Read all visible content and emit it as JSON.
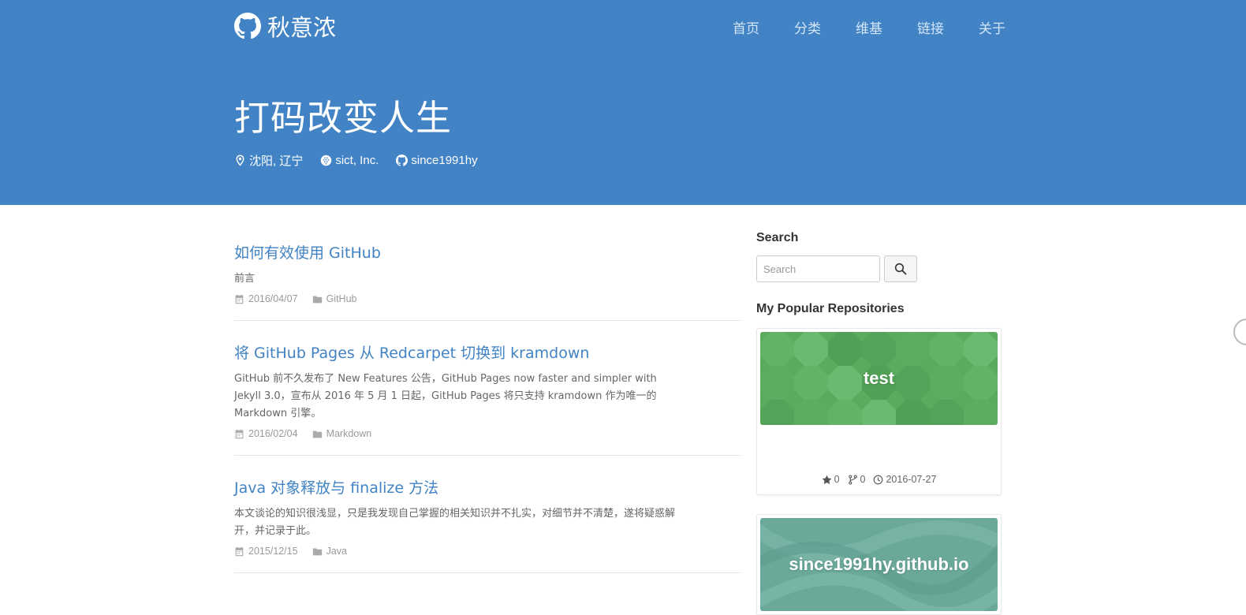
{
  "header": {
    "brand_name": "秋意浓",
    "nav": [
      "首页",
      "分类",
      "维基",
      "链接",
      "关于"
    ],
    "title": "打码改变人生",
    "location": "沈阳, 辽宁",
    "company": "sict, Inc.",
    "github_user": "since1991hy",
    "colors": {
      "background": "#4183c4",
      "text": "#ffffff"
    }
  },
  "posts": [
    {
      "title": "如何有效使用 GitHub",
      "excerpt": "前言",
      "date": "2016/04/07",
      "category": "GitHub"
    },
    {
      "title": "将 GitHub Pages 从 Redcarpet 切换到 kramdown",
      "excerpt": "GitHub 前不久发布了 New Features 公告，GitHub Pages now faster and simpler with Jekyll 3.0，宣布从 2016 年 5 月 1 日起，GitHub Pages 将只支持 kramdown 作为唯一的 Markdown 引擎。",
      "date": "2016/02/04",
      "category": "Markdown"
    },
    {
      "title": "Java 对象释放与 finalize 方法",
      "excerpt": "本文谈论的知识很浅显，只是我发现自己掌握的相关知识并不扎实，对细节并不清楚，遂将疑惑解开，并记录于此。",
      "date": "2015/12/15",
      "category": "Java"
    }
  ],
  "sidebar": {
    "search_heading": "Search",
    "search_placeholder": "Search",
    "search_value": "",
    "repos_heading": "My Popular Repositories",
    "repos": [
      {
        "name": "test",
        "stars": "0",
        "forks": "0",
        "date": "2016-07-27",
        "banner_color": "#5aab5e",
        "pattern": "octagons"
      },
      {
        "name": "since1991hy.github.io",
        "banner_color": "#6aa89a",
        "pattern": "waves"
      }
    ]
  },
  "icons": {
    "brand": "github-icon",
    "location": "map-pin-icon",
    "company": "organization-icon",
    "github": "github-icon",
    "date": "calendar-icon",
    "category": "folder-icon",
    "search": "magnifier-icon",
    "stars": "star-icon",
    "forks": "fork-icon",
    "updated": "clock-icon"
  }
}
